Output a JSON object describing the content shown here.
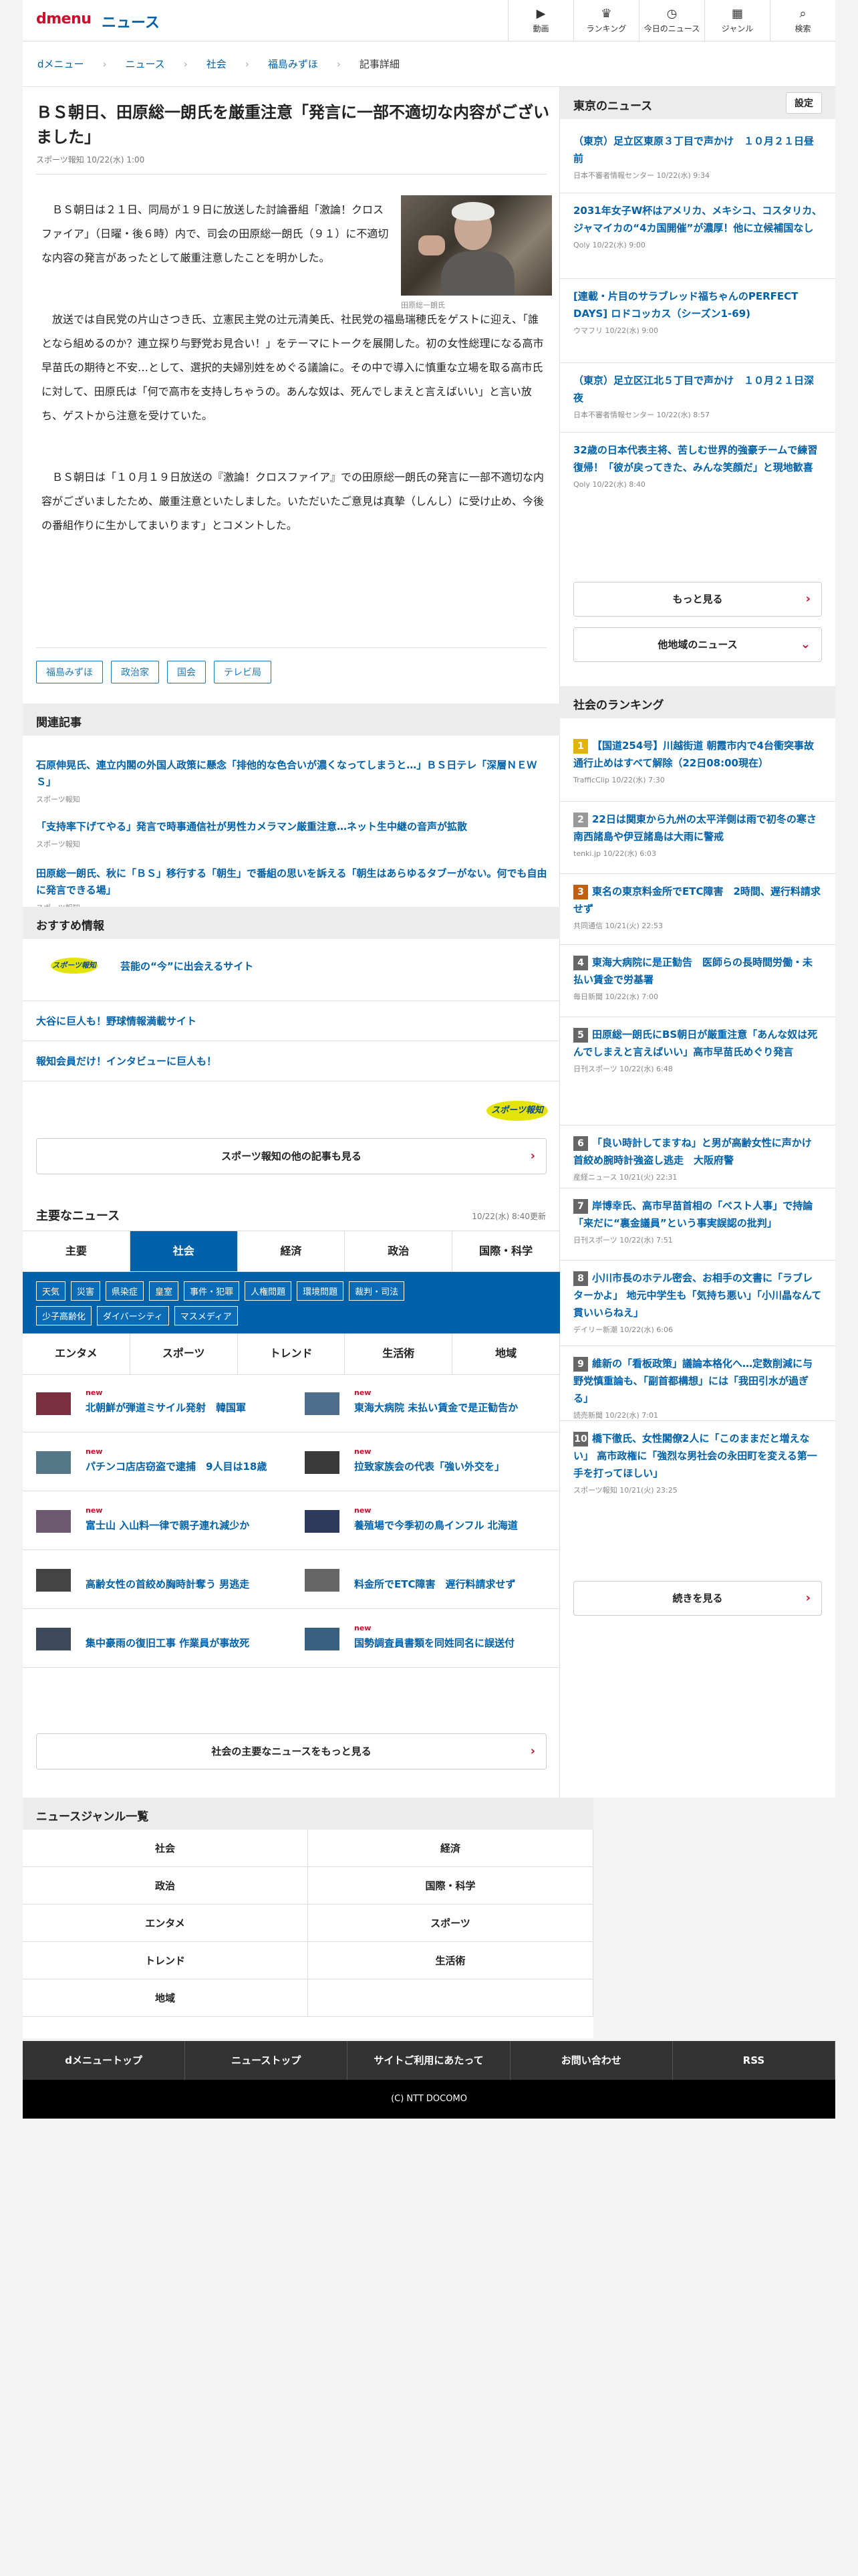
{
  "header": {
    "logo": "dmenu",
    "section": "ニュース",
    "nav": [
      {
        "icon": "video-icon",
        "glyph": "▶",
        "label": "動画"
      },
      {
        "icon": "trophy-icon",
        "glyph": "♛",
        "label": "ランキング"
      },
      {
        "icon": "clock-icon",
        "glyph": "◷",
        "label": "今日のニュース"
      },
      {
        "icon": "grid-icon",
        "glyph": "▦",
        "label": "ジャンル"
      },
      {
        "icon": "search-icon",
        "glyph": "⌕",
        "label": "検索"
      }
    ]
  },
  "breadcrumb": [
    "dメニュー",
    "ニュース",
    "社会",
    "福島みずほ",
    "記事詳細"
  ],
  "article": {
    "title": "ＢＳ朝日、田原総一朗氏を厳重注意「発言に一部不適切な内容がございました」",
    "meta": "スポーツ報知 10/22(水) 1:00",
    "photo_caption": "田原総一朗氏",
    "p1": "ＢＳ朝日は２１日、同局が１９日に放送した討論番組「激論！クロスファイア」（日曜・後６時）内で、司会の田原総一朗氏（９１）に不適切な内容の発言があったとして厳重注意したことを明かした。",
    "p2": "放送では自民党の片山さつき氏、立憲民主党の辻元清美氏、社民党の福島瑞穂氏をゲストに迎え、「誰となら組めるのか？連立探り与野党お見合い！」をテーマにトークを展開した。初の女性総理になる高市早苗氏の期待と不安…として、選択的夫婦別姓をめぐる議論に。その中で導入に慎重な立場を取る高市氏に対して、田原氏は「何で高市を支持しちゃうの。あんな奴は、死んでしまえと言えばいい」と言い放ち、ゲストから注意を受けていた。",
    "p3": "ＢＳ朝日は「１０月１９日放送の『激論！クロスファイア』での田原総一朗氏の発言に一部不適切な内容がございましたため、厳重注意といたしました。いただいたご意見は真摯（しんし）に受け止め、今後の番組作りに生かしてまいります」とコメントした。",
    "tags": [
      "福島みずほ",
      "政治家",
      "国会",
      "テレビ局"
    ]
  },
  "related": {
    "heading": "関連記事",
    "items": [
      {
        "title": "石原伸晃氏、連立内閣の外国人政策に懸念「排他的な色合いが濃くなってしまうと…」ＢＳ日テレ「深層ＮＥＷＳ」",
        "source": "スポーツ報知"
      },
      {
        "title": "「支持率下げてやる」発言で時事通信社が男性カメラマン厳重注意…ネット生中継の音声が拡散",
        "source": "スポーツ報知"
      },
      {
        "title": "田原総一朗氏、秋に「ＢＳ」移行する「朝生」で番組の思いを訴える「朝生はあらゆるタブーがない。何でも自由に発言できる場」",
        "source": "スポーツ報知"
      }
    ]
  },
  "recommend": {
    "heading": "おすすめ情報",
    "logo": "スポーツ報知",
    "items": [
      "芸能の“今”に出会えるサイト",
      "大谷に巨人も！野球情報満載サイト",
      "報知会員だけ！インタビューに巨人も！"
    ],
    "more": "スポーツ報知の他の記事も見る"
  },
  "major": {
    "heading": "主要なニュース",
    "updated": "10/22(水) 8:40更新",
    "tabs": [
      "主要",
      "社会",
      "経済",
      "政治",
      "国際・科学"
    ],
    "tag_rows": [
      [
        "天気",
        "災害",
        "県染症",
        "皇室",
        "事件・犯罪",
        "人権問題",
        "環境問題",
        "裁判・司法"
      ],
      [
        "少子高齢化",
        "ダイバーシティ",
        "マスメディア"
      ]
    ],
    "genres": [
      "エンタメ",
      "スポーツ",
      "トレンド",
      "生活術",
      "地域"
    ],
    "news": [
      {
        "new": "new",
        "title": "北朝鮮が弾道ミサイル発射　韓国軍"
      },
      {
        "new": "new",
        "title": "東海大病院 未払い賃金で是正勧告か"
      },
      {
        "new": "new",
        "title": "パチンコ店店窃盗で逮捕　9人目は18歳"
      },
      {
        "new": "new",
        "title": "拉致家族会の代表「強い外交を」"
      },
      {
        "new": "new",
        "title": "富士山 入山料一律で親子連れ減少か"
      },
      {
        "new": "new",
        "title": "養殖場で今季初の鳥インフル 北海道"
      },
      {
        "new": "",
        "title": "高齢女性の首絞め胸時計奪う 男逃走"
      },
      {
        "new": "",
        "title": "料金所でETC障害　遅行料請求せず"
      },
      {
        "new": "",
        "title": "集中豪雨の復旧工事 作業員が事故死"
      },
      {
        "new": "new",
        "title": "国勢調査員書類を同姓同名に誤送付"
      }
    ],
    "more": "社会の主要なニュースをもっと見る"
  },
  "genre_list": {
    "heading": "ニュースジャンル一覧",
    "items": [
      "社会",
      "経済",
      "政治",
      "国際・科学",
      "エンタメ",
      "スポーツ",
      "トレンド",
      "生活術",
      "地域",
      ""
    ]
  },
  "side_news": {
    "heading": "東京のニュース",
    "setting": "設定",
    "items": [
      {
        "title": "（東京）足立区東原３丁目で声かけ　１０月２１日昼前",
        "source": "日本不審者情報センター 10/22(水) 9:34"
      },
      {
        "title": "2031年女子W杯はアメリカ、メキシコ、コスタリカ、ジャマイカの“4カ国開催”が濃厚！他に立候補国なし",
        "source": "Qoly 10/22(水) 9:00"
      },
      {
        "title": "[連載・片目のサラブレッド福ちゃんのPERFECT DAYS] ロドコッカス（シーズン1-69)",
        "source": "ウマフリ 10/22(水) 9:00"
      },
      {
        "title": "（東京）足立区江北５丁目で声かけ　１０月２１日深夜",
        "source": "日本不審者情報センター 10/22(水) 8:57"
      },
      {
        "title": "32歳の日本代表主将、苦しむ世界的強豪チームで練習復帰！「彼が戻ってきた、みんな笑顔だ」と現地歓喜",
        "source": "Qoly 10/22(水) 8:40"
      }
    ],
    "more": "もっと見る",
    "other": "他地域のニュース"
  },
  "ranking": {
    "heading": "社会のランキング",
    "items": [
      {
        "n": "1",
        "title": "【国道254号】川越街道 朝霞市内で4台衝突事故 通行止めはすべて解除（22日08:00現在）",
        "source": "TrafficClip 10/22(水) 7:30"
      },
      {
        "n": "2",
        "title": "22日は関東から九州の太平洋側は雨で初冬の寒さ　南西諸島や伊豆諸島は大雨に警戒",
        "source": "tenki.jp 10/22(水) 6:03"
      },
      {
        "n": "3",
        "title": "東名の東京料金所でETC障害　2時間、遅行料請求せず",
        "source": "共同通信 10/21(火) 22:53"
      },
      {
        "n": "4",
        "title": "東海大病院に是正勧告　医師らの長時間労働・未払い賃金で労基署",
        "source": "毎日新聞 10/22(水) 7:00"
      },
      {
        "n": "5",
        "title": "田原総一朗氏にBS朝日が厳重注意「あんな奴は死んでしまえと言えばいい」高市早苗氏めぐり発言",
        "source": "日刊スポーツ 10/22(水) 6:48"
      },
      {
        "n": "6",
        "title": "「良い時計してますね」と男が高齢女性に声かけ　首絞め腕時計強盗し逃走　大阪府警",
        "source": "産経ニュース 10/21(火) 22:31"
      },
      {
        "n": "7",
        "title": "岸博幸氏、高市早苗首相の「ベスト人事」で持論「来だに“裏金議員”という事実誤認の批判」",
        "source": "日刊スポーツ 10/22(水) 7:51"
      },
      {
        "n": "8",
        "title": "小川市長のホテル密会、お相手の文書に「ラブレターかよ」 地元中学生も「気持ち悪い」「小川晶なんて貫いいらねえ」",
        "source": "デイリー新潮 10/22(水) 6:06"
      },
      {
        "n": "9",
        "title": "維新の「看板政策」議論本格化へ…定数削減に与野党慎重論も、「副首都構想」には「我田引水が過ぎる」",
        "source": "読売新聞 10/22(水) 7:01"
      },
      {
        "n": "10",
        "title": "橋下徹氏、女性閣僚2人に「このままだと増えない」 高市政権に「強烈な男社会の永田町を変える第一手を打ってほしい」",
        "source": "スポーツ報知 10/21(火) 23:25"
      }
    ],
    "more": "続きを見る"
  },
  "footer": {
    "nav": [
      "dメニュートップ",
      "ニューストップ",
      "サイトご利用にあたって",
      "お問い合わせ",
      "RSS"
    ],
    "copyright": "(C) NTT DOCOMO"
  },
  "colors": {
    "brand_red": "#c8102e",
    "link_blue": "#0060a8",
    "tab_active": "#0060a8"
  }
}
